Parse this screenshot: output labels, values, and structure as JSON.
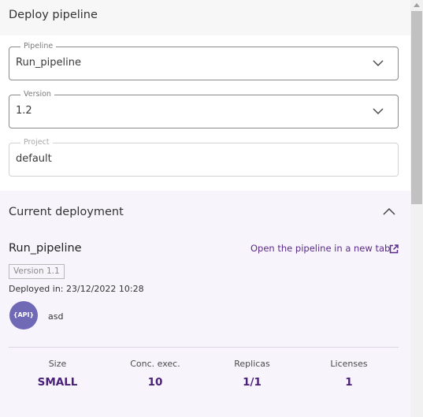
{
  "header": {
    "title": "Deploy pipeline"
  },
  "form": {
    "pipeline": {
      "label": "Pipeline",
      "value": "Run_pipeline"
    },
    "version": {
      "label": "Version",
      "value": "1.2"
    },
    "project": {
      "label": "Project",
      "value": "default"
    }
  },
  "current_deployment": {
    "title": "Current deployment",
    "pipeline_name": "Run_pipeline",
    "open_link": "Open the pipeline in a new tab",
    "version_chip": "Version 1.1",
    "deployed_in": "Deployed in: 23/12/2022 10:28",
    "avatar_text": "{API}",
    "avatar_label": "asd",
    "stats": [
      {
        "label": "Size",
        "value": "SMALL"
      },
      {
        "label": "Conc. exec.",
        "value": "10"
      },
      {
        "label": "Replicas",
        "value": "1/1"
      },
      {
        "label": "Licenses",
        "value": "1"
      }
    ]
  },
  "colors": {
    "accent": "#5b2a8a",
    "stat_value": "#4a1f7a",
    "avatar_bg": "#6f69b6",
    "section_bg": "#f7f4fb"
  },
  "icons": {
    "dropdown": "chevron-down-icon",
    "collapse": "chevron-up-icon",
    "open_link": "external-link-icon"
  }
}
